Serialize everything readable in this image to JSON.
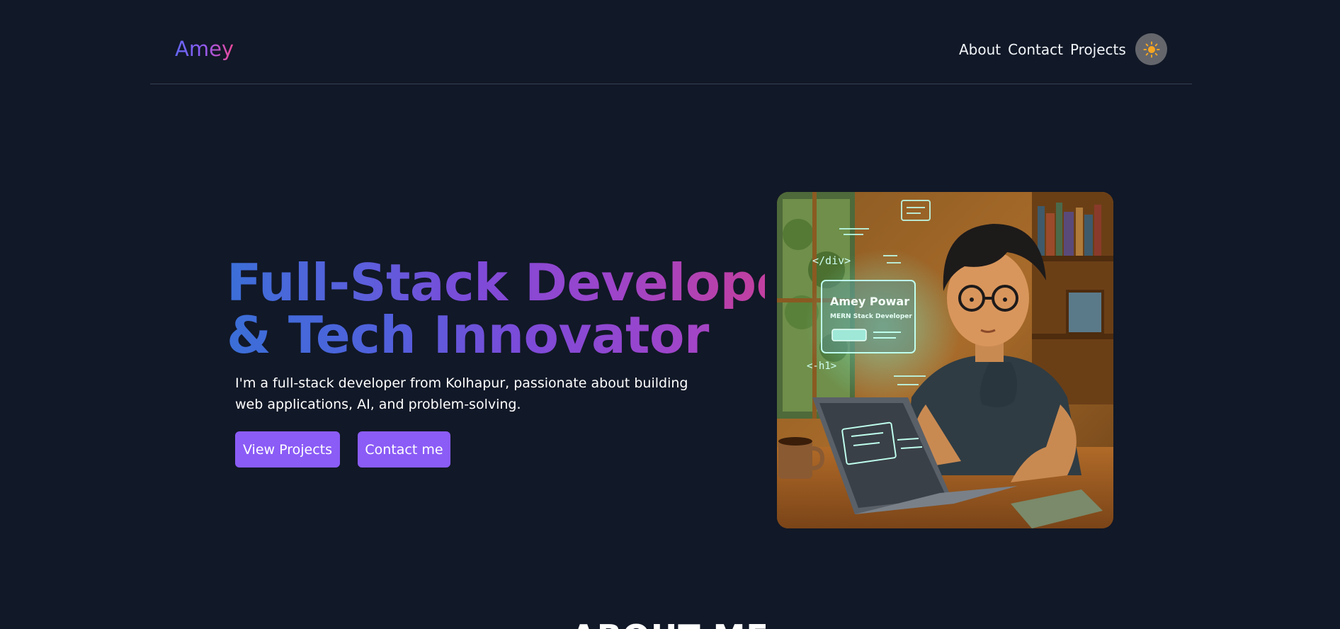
{
  "nav": {
    "brand": "Amey",
    "links": [
      "About",
      "Contact",
      "Projects"
    ],
    "theme_toggle_icon": "sun-icon"
  },
  "hero": {
    "title_line1": "Full-Stack Developer",
    "title_line2": "& Tech Innovator",
    "description": "I'm a full-stack developer from Kolhapur, passionate about building web applications, AI, and problem-solving.",
    "buttons": {
      "projects": "View Projects",
      "contact": "Contact me"
    },
    "image": {
      "card_name": "Amey Powar",
      "card_role": "MERN Stack Developer",
      "code_tag_div": "</div>",
      "code_tag_h1": "<-h1>"
    }
  },
  "about": {
    "title": "ABOUT ME"
  },
  "colors": {
    "background": "#111827",
    "accent": "#8b5cf6",
    "gradient_start": "#3b6fd8",
    "gradient_end": "#c23f9f",
    "toggle_bg": "#64666c",
    "sun": "#f5a623"
  }
}
